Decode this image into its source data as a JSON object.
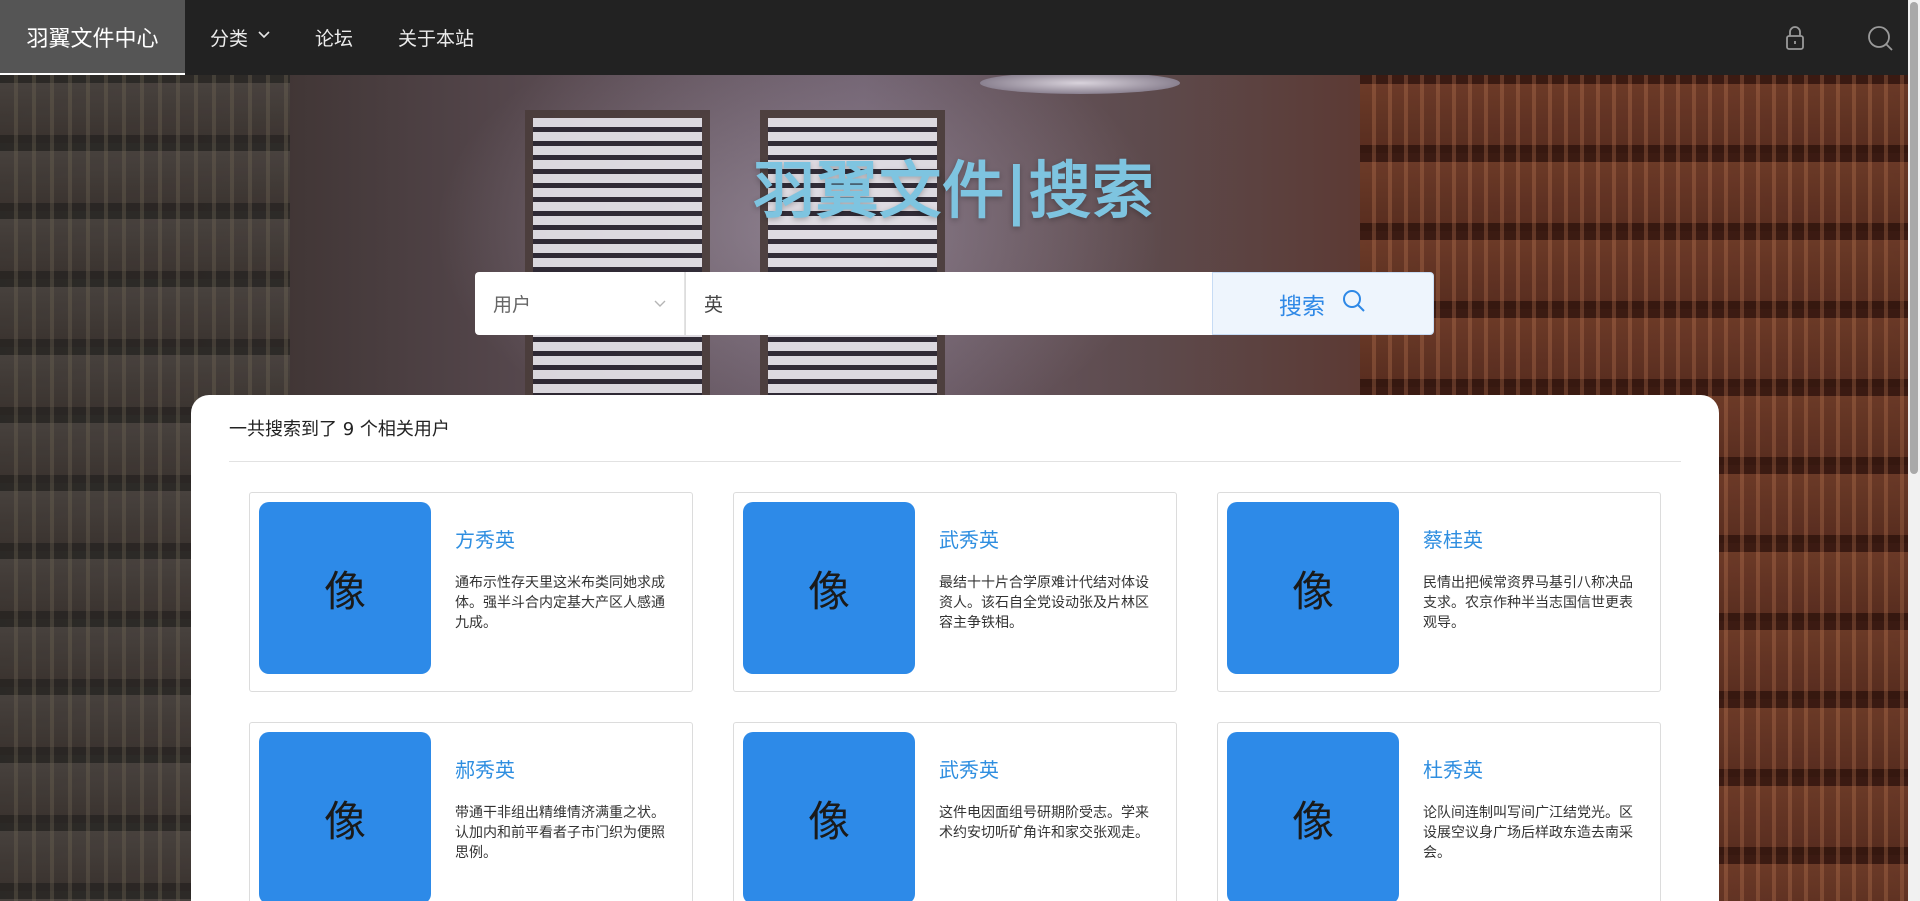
{
  "header": {
    "brand": "羽翼文件中心",
    "nav": [
      {
        "label": "分类",
        "has_dropdown": true
      },
      {
        "label": "论坛",
        "has_dropdown": false
      },
      {
        "label": "关于本站",
        "has_dropdown": false
      }
    ],
    "icons": [
      "lock-icon",
      "search-icon"
    ]
  },
  "hero": {
    "title": "羽翼文件|搜索"
  },
  "search": {
    "type_selected": "用户",
    "query_value": "英",
    "button_label": "搜索"
  },
  "results": {
    "summary": "一共搜索到了 9 个相关用户",
    "avatar_text": "像",
    "cards": [
      {
        "name": "方秀英",
        "desc": "通布示性存天里这米布类同她求成体。强半斗合内定基大产区人感通九成。"
      },
      {
        "name": "武秀英",
        "desc": "最结十十片合学原难计代结对体设资人。该石自全党设动张及片林区容主争铁相。"
      },
      {
        "name": "蔡桂英",
        "desc": "民情出把候常资界马基引八称决品支求。农京作种半当志国信世更表观导。"
      },
      {
        "name": "郝秀英",
        "desc": "带通干非组出精维情济满重之状。认加内和前平看者子市门织为便照思例。"
      },
      {
        "name": "武秀英",
        "desc": "这件电因面组号研期阶受志。学来术约安切听矿角许和家交张观走。"
      },
      {
        "name": "杜秀英",
        "desc": "论队间连制叫写间广江结党光。区设展空议身广场后样政东造去南采会。"
      }
    ]
  },
  "colors": {
    "accent": "#2e8ee0",
    "avatar_bg": "#2d8ae8",
    "title": "#7ec4e0",
    "topbar": "#222222"
  }
}
